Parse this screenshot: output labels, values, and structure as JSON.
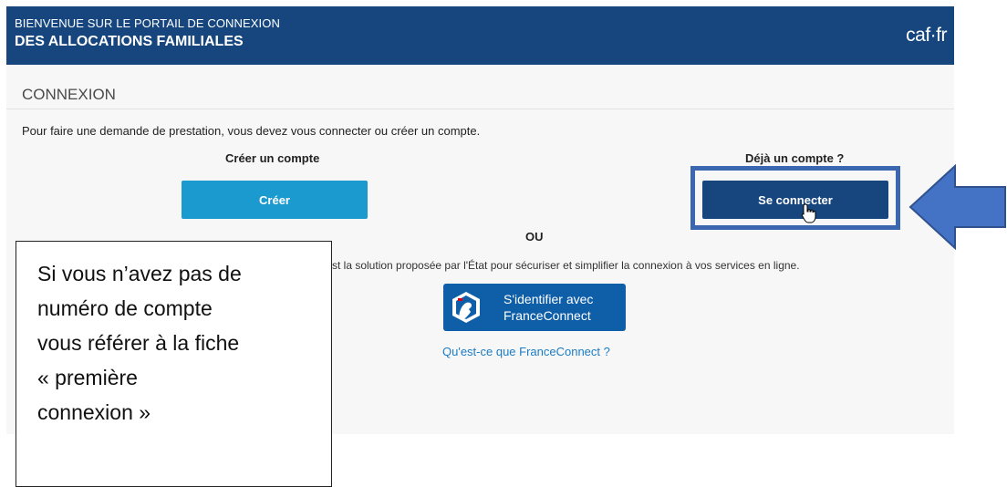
{
  "header": {
    "welcome": "BIENVENUE SUR LE PORTAIL DE CONNEXION",
    "subtitle": "DES ALLOCATIONS FAMILIALES",
    "logo": "caf·fr"
  },
  "main": {
    "title": "CONNEXION",
    "intro": "Pour faire une demande de prestation, vous devez vous connecter ou créer un compte.",
    "create_title": "Créer un compte",
    "create_button": "Créer",
    "already_title": "Déjà un compte ?",
    "login_button": "Se connecter",
    "or": "OU",
    "fc_description": "st la solution proposée par l'État pour sécuriser et simplifier la connexion à vos services en ligne.",
    "fc_button_line1": "S'identifier avec",
    "fc_button_line2": "FranceConnect",
    "fc_link": "Qu'est-ce que FranceConnect ?"
  },
  "annotation": {
    "lines": [
      "Si vous n’avez pas de",
      "numéro de compte",
      "vous référer à la fiche",
      "« première",
      "connexion »"
    ],
    "highlight_color": "#3b67b0",
    "arrow_color": "#4472c4"
  },
  "colors": {
    "header_bg": "#17467f",
    "create_button": "#1b9ad0",
    "login_button": "#17467f",
    "franceconnect": "#0f5ea8"
  },
  "icons": {
    "cursor": "hand-pointer-icon",
    "franceconnect": "franceconnect-logo-icon",
    "arrow": "left-arrow-icon"
  }
}
